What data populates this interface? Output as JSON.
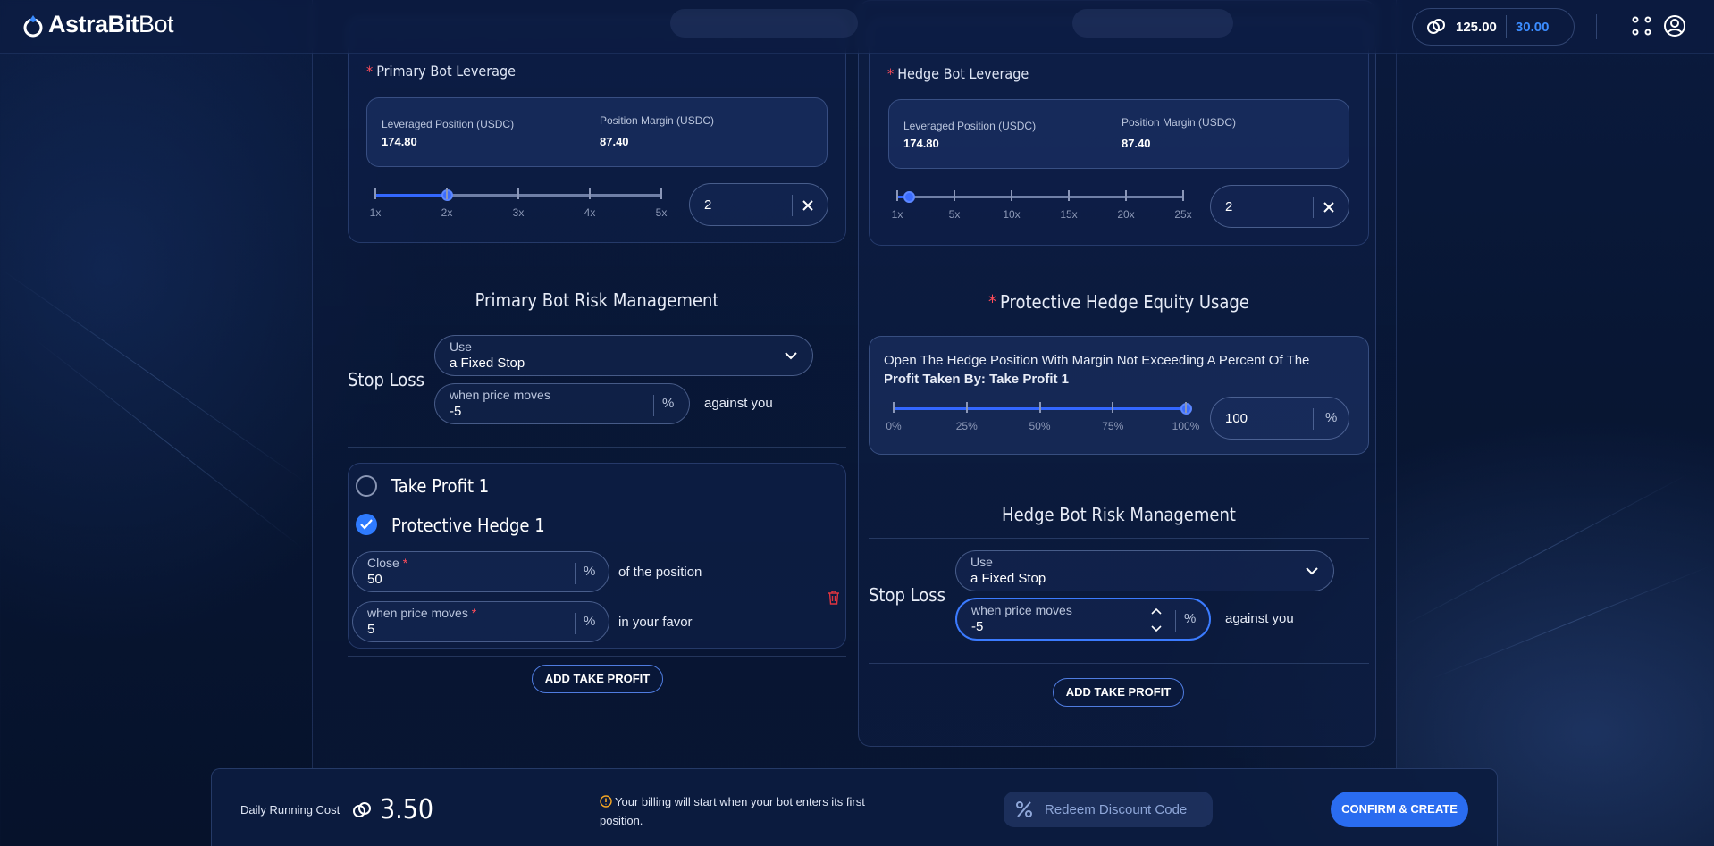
{
  "app": {
    "logo_bold": "AstraBit",
    "logo_light": "Bot"
  },
  "header": {
    "balance_primary": "125.00",
    "balance_secondary": "30.00"
  },
  "primary": {
    "leverage_label": "Primary Bot Leverage",
    "leveraged_position_label": "Leveraged Position (USDC)",
    "leveraged_position_value": "174.80",
    "position_margin_label": "Position Margin (USDC)",
    "position_margin_value": "87.40",
    "leverage_ticks": [
      "1x",
      "2x",
      "3x",
      "4x",
      "5x"
    ],
    "leverage_value": "2",
    "leverage_fraction": 0.25,
    "risk_title": "Primary Bot Risk Management",
    "stop_loss_label": "Stop Loss",
    "use_label": "Use",
    "use_value": "a Fixed Stop",
    "price_moves_label": "when price moves",
    "price_moves_value": "-5",
    "percent": "%",
    "against": "against you",
    "take_profit_label": "Take Profit 1",
    "hedge_label": "Protective Hedge 1",
    "close_label": "Close",
    "close_value": "50",
    "of_position": "of the position",
    "tp_moves_label": "when price moves",
    "tp_moves_value": "5",
    "in_favor": "in your favor",
    "add_tp": "ADD TAKE PROFIT"
  },
  "hedge": {
    "leverage_label": "Hedge Bot Leverage",
    "leveraged_position_label": "Leveraged Position (USDC)",
    "leveraged_position_value": "174.80",
    "position_margin_label": "Position Margin (USDC)",
    "position_margin_value": "87.40",
    "leverage_ticks": [
      "1x",
      "5x",
      "10x",
      "15x",
      "20x",
      "25x"
    ],
    "leverage_value": "2",
    "leverage_fraction": 0.04,
    "equity_title": "Protective Hedge Equity Usage",
    "equity_text": "Open The Hedge Position With Margin Not Exceeding A Percent Of The",
    "equity_text_bold": "Profit Taken By: Take Profit 1",
    "equity_ticks": [
      "0%",
      "25%",
      "50%",
      "75%",
      "100%"
    ],
    "equity_value": "100",
    "equity_fraction": 1.0,
    "percent": "%",
    "risk_title": "Hedge Bot Risk Management",
    "stop_loss_label": "Stop Loss",
    "use_label": "Use",
    "use_value": "a Fixed Stop",
    "price_moves_label": "when price moves",
    "price_moves_value": "-5",
    "against": "against you",
    "add_tp": "ADD TAKE PROFIT"
  },
  "footer": {
    "cost_label": "Daily Running Cost",
    "cost_value": "3.50",
    "billing_note": "Your billing will start when your bot enters its first position.",
    "redeem": "Redeem Discount Code",
    "confirm": "CONFIRM & CREATE"
  },
  "colors": {
    "accent": "#2a6cf0",
    "required": "#ff4d5a",
    "secondary_balance": "#3b8cff"
  }
}
